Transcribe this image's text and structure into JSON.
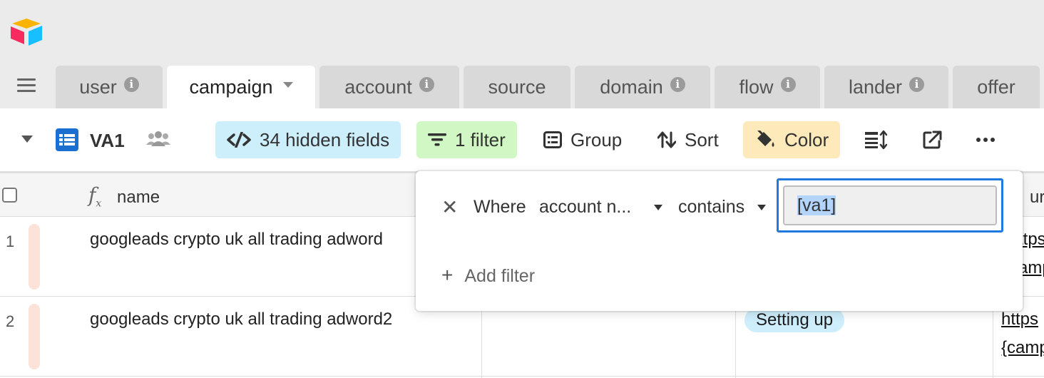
{
  "tabs": [
    {
      "label": "user",
      "info": true
    },
    {
      "label": "campaign",
      "active": true
    },
    {
      "label": "account",
      "info": true
    },
    {
      "label": "source",
      "info": false
    },
    {
      "label": "domain",
      "info": true
    },
    {
      "label": "flow",
      "info": true
    },
    {
      "label": "lander",
      "info": true
    },
    {
      "label": "offer",
      "info": false
    }
  ],
  "toolbar": {
    "view_name": "VA1",
    "hidden_fields_label": "34 hidden fields",
    "filter_label": "1 filter",
    "group_label": "Group",
    "sort_label": "Sort",
    "color_label": "Color"
  },
  "grid": {
    "primary_header": "name",
    "rows": [
      {
        "num": "1",
        "name": "googleads crypto uk all  trading adword",
        "status": "",
        "url": [
          "ttps",
          "amp"
        ]
      },
      {
        "num": "2",
        "name": "googleads crypto uk all  trading adword2",
        "status": "Setting up",
        "url": [
          "https",
          "{camp"
        ]
      }
    ],
    "url_header": "ur"
  },
  "filter": {
    "where_label": "Where",
    "field": "account n...",
    "operator": "contains",
    "value": "[va1]",
    "add_label": "Add filter"
  },
  "colors": {
    "hidden_fields_bg": "#cdeefb",
    "filter_bg": "#d1f7c4",
    "color_bg": "#fde9b9",
    "status_pill_bg": "#cfeefc",
    "accent_blue": "#1f7ae0"
  }
}
